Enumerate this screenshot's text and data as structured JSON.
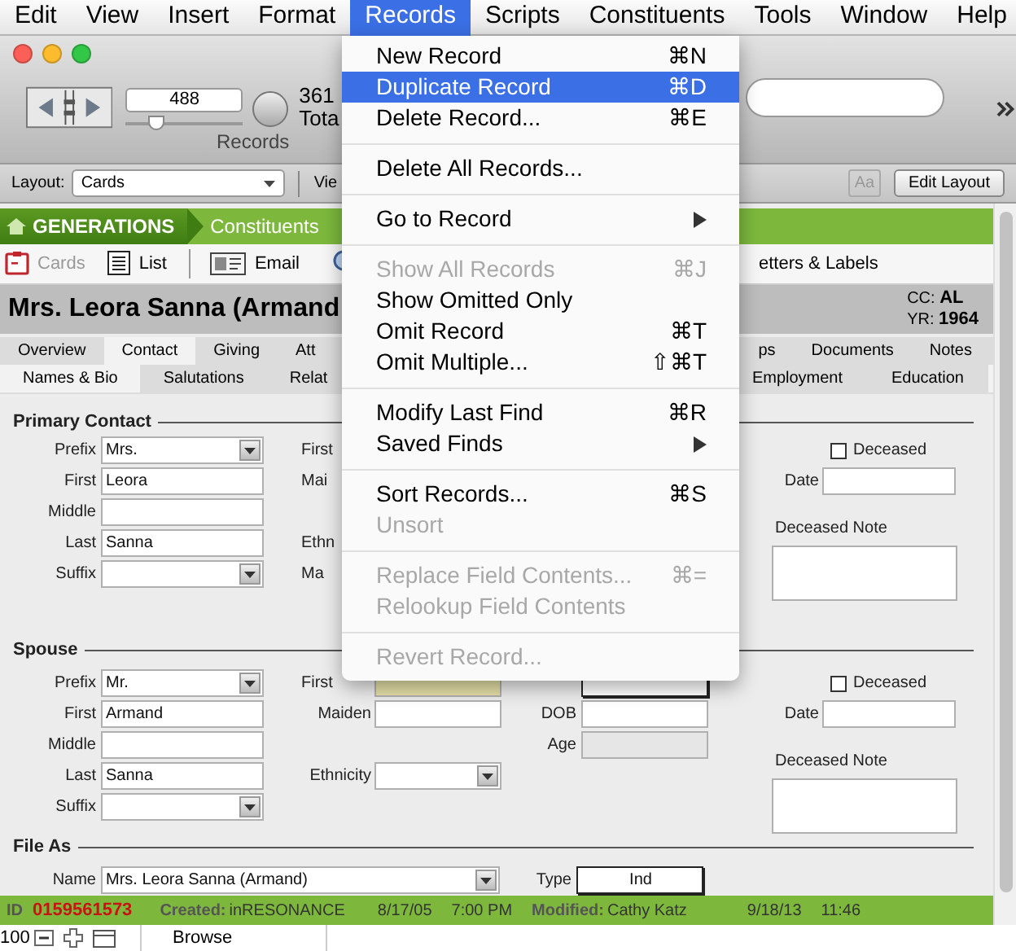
{
  "menu_bar": [
    {
      "label": "Edit",
      "selected": false
    },
    {
      "label": "View",
      "selected": false
    },
    {
      "label": "Insert",
      "selected": false
    },
    {
      "label": "Format",
      "selected": false
    },
    {
      "label": "Records",
      "selected": true
    },
    {
      "label": "Scripts",
      "selected": false
    },
    {
      "label": "Constituents",
      "selected": false
    },
    {
      "label": "Tools",
      "selected": false
    },
    {
      "label": "Window",
      "selected": false
    },
    {
      "label": "Help",
      "selected": false
    }
  ],
  "toolbar": {
    "record_number": "488",
    "level": 0.22,
    "records_label": "Records",
    "found_count": "361",
    "total_label": "Tota"
  },
  "layout_bar": {
    "label": "Layout:",
    "layout": "Cards",
    "view_label": "Vie",
    "aa_button": {
      "label": "Aa",
      "disabled": true
    },
    "edit_button": "Edit Layout"
  },
  "banner": {
    "app": "GENERATIONS",
    "section": "Constituents"
  },
  "nav": [
    {
      "label": "Cards",
      "kind": "cards",
      "selected": true
    },
    {
      "label": "List",
      "kind": "list",
      "selected": false
    },
    {
      "label": "Email",
      "kind": "email",
      "selected": false
    }
  ],
  "nav_right": "etters & Labels",
  "record": {
    "name": "Mrs. Leora Sanna (Armand",
    "cc_label": "CC:",
    "cc": "AL",
    "yr_label": "YR:",
    "yr": "1964"
  },
  "tabs_left": [
    {
      "label": "Overview",
      "selected": false
    },
    {
      "label": "Contact",
      "selected": true
    },
    {
      "label": "Giving",
      "selected": false
    },
    {
      "label": "Att",
      "selected": false
    }
  ],
  "tabs_right": [
    {
      "label": "ps",
      "selected": false
    },
    {
      "label": "Documents",
      "selected": false
    },
    {
      "label": "Notes",
      "selected": false
    }
  ],
  "subtabs_left": [
    {
      "label": "Names & Bio",
      "selected": true
    },
    {
      "label": "Salutations",
      "selected": false
    },
    {
      "label": "Relat",
      "selected": false
    }
  ],
  "subtabs_right": [
    {
      "label": "Employment",
      "selected": false
    },
    {
      "label": "Education",
      "selected": false
    }
  ],
  "primary_contact": {
    "title": "Primary Contact",
    "fields": [
      {
        "label": "Prefix",
        "value": "Mrs.",
        "kind": "select"
      },
      {
        "label": "First",
        "value": "Leora",
        "kind": "text"
      },
      {
        "label": "Middle",
        "kind": "text"
      },
      {
        "label": "Last",
        "value": "Sanna",
        "kind": "text"
      },
      {
        "label": "Suffix",
        "kind": "select"
      }
    ],
    "middle": [
      {
        "label": "First",
        "kind": "label_only"
      },
      {
        "label": "Mai",
        "kind": "label_only"
      },
      {
        "kind": "empty"
      },
      {
        "label": "Ethn",
        "kind": "label_only"
      },
      {
        "label": "Ma",
        "kind": "label_only"
      }
    ],
    "deceased": {
      "label": "Deceased",
      "checked": false
    },
    "date_label": "Date",
    "note_label": "Deceased Note"
  },
  "spouse": {
    "title": "Spouse",
    "fields": [
      {
        "label": "Prefix",
        "value": "Mr.",
        "kind": "select"
      },
      {
        "label": "First",
        "value": "Armand",
        "kind": "text"
      },
      {
        "label": "Middle",
        "kind": "text"
      },
      {
        "label": "Last",
        "value": "Sanna",
        "kind": "text"
      },
      {
        "label": "Suffix",
        "kind": "select"
      }
    ],
    "middle": [
      {
        "label": "First",
        "kind": "highlight"
      },
      {
        "label": "Maiden",
        "kind": "text"
      },
      {
        "kind": "empty"
      },
      {
        "label": "Ethnicity",
        "kind": "select"
      },
      {
        "kind": "empty"
      }
    ],
    "third": [
      {
        "kind": "boxed"
      },
      {
        "label": "DOB",
        "kind": "text"
      },
      {
        "label": "Age",
        "kind": "readonly"
      }
    ],
    "deceased": {
      "label": "Deceased",
      "checked": false
    },
    "date_label": "Date",
    "note_label": "Deceased Note"
  },
  "file_as": {
    "title": "File As",
    "name_label": "Name",
    "name_value": "Mrs. Leora Sanna (Armand)",
    "type_label": "Type",
    "type_value": "Ind"
  },
  "footer": {
    "id_label": "ID",
    "id": "0159561573",
    "created_label": "Created:",
    "created_by": "inRESONANCE",
    "created_date": "8/17/05",
    "created_time": "7:00 PM",
    "modified_label": "Modified:",
    "modified_by": "Cathy Katz",
    "modified_date": "9/18/13",
    "modified_time": "11:46"
  },
  "status_bar": {
    "zoom": "100",
    "mode": "Browse"
  },
  "menu": {
    "items": [
      {
        "kind": "item",
        "label": "New Record",
        "shortcut": "⌘N",
        "disabled": false,
        "selected": false
      },
      {
        "kind": "item",
        "label": "Duplicate Record",
        "shortcut": "⌘D",
        "disabled": false,
        "selected": true
      },
      {
        "kind": "item",
        "label": "Delete Record...",
        "shortcut": "⌘E",
        "disabled": false,
        "selected": false
      },
      {
        "kind": "separator"
      },
      {
        "kind": "item",
        "label": "Delete All Records...",
        "disabled": false,
        "selected": false
      },
      {
        "kind": "separator"
      },
      {
        "kind": "submenu",
        "label": "Go to Record",
        "disabled": false,
        "selected": false
      },
      {
        "kind": "separator"
      },
      {
        "kind": "item",
        "label": "Show All Records",
        "shortcut": "⌘J",
        "disabled": true,
        "selected": false
      },
      {
        "kind": "item",
        "label": "Show Omitted Only",
        "disabled": false,
        "selected": false
      },
      {
        "kind": "item",
        "label": "Omit Record",
        "shortcut": "⌘T",
        "disabled": false,
        "selected": false
      },
      {
        "kind": "item",
        "label": "Omit Multiple...",
        "shortcut": "⇧⌘T",
        "disabled": false,
        "selected": false
      },
      {
        "kind": "separator"
      },
      {
        "kind": "item",
        "label": "Modify Last Find",
        "shortcut": "⌘R",
        "disabled": false,
        "selected": false
      },
      {
        "kind": "submenu",
        "label": "Saved Finds",
        "disabled": false,
        "selected": false
      },
      {
        "kind": "separator"
      },
      {
        "kind": "item",
        "label": "Sort Records...",
        "shortcut": "⌘S",
        "disabled": false,
        "selected": false
      },
      {
        "kind": "item",
        "label": "Unsort",
        "disabled": true,
        "selected": false
      },
      {
        "kind": "separator"
      },
      {
        "kind": "item",
        "label": "Replace Field Contents...",
        "shortcut": "⌘=",
        "disabled": true,
        "selected": false
      },
      {
        "kind": "item",
        "label": "Relookup Field Contents",
        "disabled": true,
        "selected": false
      },
      {
        "kind": "separator"
      },
      {
        "kind": "item",
        "label": "Revert Record...",
        "disabled": true,
        "selected": false
      }
    ]
  }
}
